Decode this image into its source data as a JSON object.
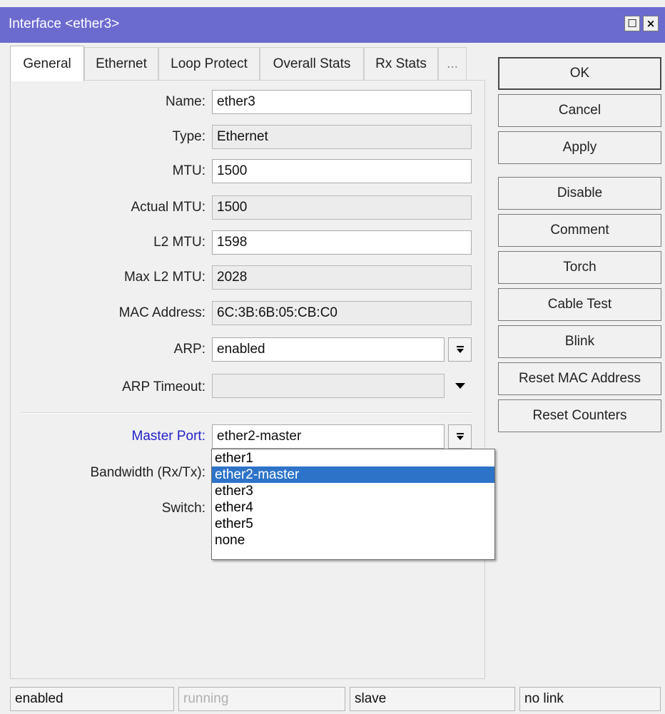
{
  "window": {
    "title": "Interface <ether3>",
    "restore_glyph": "☐",
    "close_glyph": "×"
  },
  "tabs": [
    {
      "label": "General",
      "active": true
    },
    {
      "label": "Ethernet"
    },
    {
      "label": "Loop Protect"
    },
    {
      "label": "Overall Stats"
    },
    {
      "label": "Rx Stats"
    },
    {
      "label": "..."
    }
  ],
  "form": {
    "name": {
      "label": "Name:",
      "value": "ether3"
    },
    "type": {
      "label": "Type:",
      "value": "Ethernet"
    },
    "mtu": {
      "label": "MTU:",
      "value": "1500"
    },
    "actual_mtu": {
      "label": "Actual MTU:",
      "value": "1500"
    },
    "l2_mtu": {
      "label": "L2 MTU:",
      "value": "1598"
    },
    "max_l2_mtu": {
      "label": "Max L2 MTU:",
      "value": "2028"
    },
    "mac_address": {
      "label": "MAC Address:",
      "value": "6C:3B:6B:05:CB:C0"
    },
    "arp": {
      "label": "ARP:",
      "value": "enabled"
    },
    "arp_timeout": {
      "label": "ARP Timeout:",
      "value": ""
    },
    "master_port": {
      "label": "Master Port:",
      "value": "ether2-master"
    },
    "bandwidth": {
      "label": "Bandwidth (Rx/Tx):"
    },
    "switch": {
      "label": "Switch:"
    }
  },
  "master_port_options": [
    "ether1",
    "ether2-master",
    "ether3",
    "ether4",
    "ether5",
    "none"
  ],
  "master_port_selected_index": 1,
  "buttons": {
    "ok": "OK",
    "cancel": "Cancel",
    "apply": "Apply",
    "disable": "Disable",
    "comment": "Comment",
    "torch": "Torch",
    "cable_test": "Cable Test",
    "blink": "Blink",
    "reset_mac": "Reset MAC Address",
    "reset_counters": "Reset Counters"
  },
  "status": {
    "enabled": "enabled",
    "running": "running",
    "slave": "slave",
    "link": "no link"
  },
  "colors": {
    "titlebar": "#6b6bcf",
    "selection": "#2d73c8",
    "link_label": "#2323c8"
  }
}
